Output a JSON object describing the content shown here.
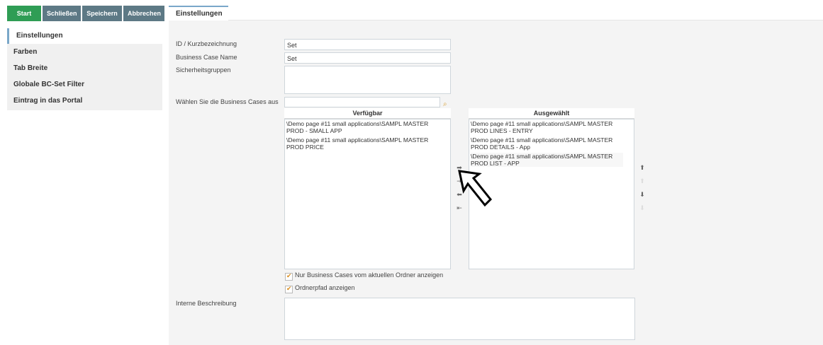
{
  "toolbar": {
    "start": "Start",
    "close": "Schließen",
    "save": "Speichern",
    "cancel": "Abbrechen"
  },
  "tab": {
    "label": "Einstellungen"
  },
  "sidebar": {
    "items": [
      {
        "label": "Einstellungen"
      },
      {
        "label": "Farben"
      },
      {
        "label": "Tab Breite"
      },
      {
        "label": "Globale BC-Set Filter"
      },
      {
        "label": "Eintrag in das Portal"
      }
    ]
  },
  "form": {
    "id_label": "ID / Kurzbezeichnung",
    "id_value": "Set",
    "name_label": "Business Case Name",
    "name_value": "Set",
    "groups_label": "Sicherheitsgruppen",
    "choose_label": "Wählen Sie die Business Cases aus",
    "available_header": "Verfügbar",
    "selected_header": "Ausgewählt",
    "available": [
      "\\Demo page #11 small applications\\SAMPL MASTER PROD - SMALL APP",
      "\\Demo page #11 small applications\\SAMPL MASTER PROD PRICE"
    ],
    "selected": [
      "\\Demo page #11 small applications\\SAMPL MASTER PROD LINES - ENTRY",
      "\\Demo page #11 small applications\\SAMPL MASTER PROD DETAILS - App",
      "\\Demo page #11 small applications\\SAMPL MASTER PROD LIST - APP"
    ],
    "check_current_folder": "Nur Business Cases vom aktuellen Ordner anzeigen",
    "check_folder_path": "Ordnerpfad anzeigen",
    "internal_desc_label": "Interne Beschreibung"
  },
  "icons": {
    "move_right": "arrow-right-icon",
    "move_all_right": "double-arrow-right-icon",
    "move_left": "arrow-left-icon",
    "move_all_left": "arrow-to-left-icon",
    "up": "arrow-up-icon",
    "down": "arrow-down-icon",
    "search": "search-icon"
  },
  "colors": {
    "start_button": "#2f9d55",
    "toolbar_button": "#5d7985",
    "accent": "#7aa7c9",
    "check": "#d98b1a"
  }
}
